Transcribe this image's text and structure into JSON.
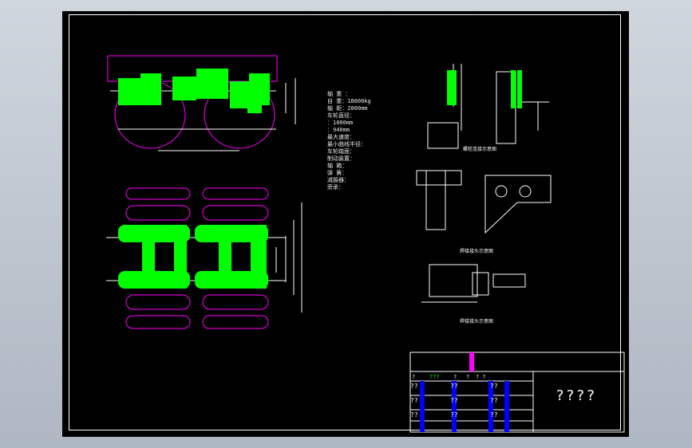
{
  "notes": [
    "轴  重 ：",
    "自  重：18000kg",
    "轴  距：2000mm",
    "车轮直径：",
    "   ：1000mm",
    "   ：940mm",
    "最大速度：",
    "最小曲线半径：",
    "车轮踏面：",
    "制动装置：",
    "轴  箱：",
    "弹  簧：",
    "减振器：",
    "旁承："
  ],
  "captions": {
    "view_a": "螺栓连接示意图",
    "view_b": "焊接接头示意图",
    "view_c": "焊接接头示意图"
  },
  "title_block": {
    "name": "????",
    "header_cells": [
      "?",
      "???",
      "?",
      "?",
      "? ?"
    ],
    "rows": [
      [
        "??",
        "??",
        "??"
      ],
      [
        "??",
        "??",
        "??"
      ],
      [
        "??",
        "??",
        "??"
      ]
    ]
  },
  "colors": {
    "background": "#000000",
    "magenta": "#ff00ff",
    "green": "#00ff00",
    "white": "#ffffff",
    "blue": "#0000ff",
    "yellow": "#ffff00"
  }
}
